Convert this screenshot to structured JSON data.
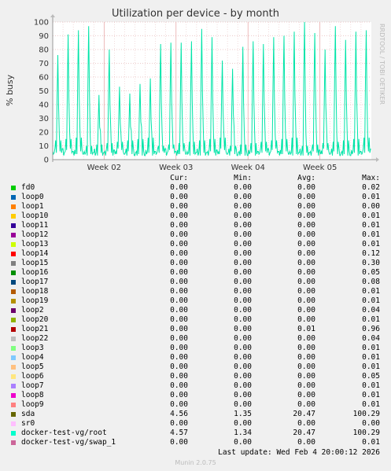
{
  "chart_data": {
    "type": "line",
    "title": "Utilization per device - by month",
    "ylabel": "% busy",
    "ylim": [
      0,
      100
    ],
    "yticks": [
      0,
      10,
      20,
      30,
      40,
      50,
      60,
      70,
      80,
      90,
      100
    ],
    "xtick_labels": [
      "Week 02",
      "Week 03",
      "Week 04",
      "Week 05"
    ],
    "grid": true,
    "series_color": "#00e4a8",
    "daily_peaks": [
      76,
      91,
      94,
      97,
      47,
      80,
      53,
      48,
      55,
      59,
      84,
      85,
      85,
      86,
      95,
      89,
      72,
      66,
      82,
      86,
      84,
      89,
      90,
      93,
      100,
      92,
      80,
      97,
      87,
      93,
      94
    ],
    "series": [
      {
        "name": "fd0",
        "color": "#00cc00",
        "cur": "0.00",
        "min": "0.00",
        "avg": "0.00",
        "max": "0.02"
      },
      {
        "name": "loop0",
        "color": "#0066b3",
        "cur": "0.00",
        "min": "0.00",
        "avg": "0.00",
        "max": "0.01"
      },
      {
        "name": "loop1",
        "color": "#ff8000",
        "cur": "0.00",
        "min": "0.00",
        "avg": "0.00",
        "max": "0.00"
      },
      {
        "name": "loop10",
        "color": "#ffcc00",
        "cur": "0.00",
        "min": "0.00",
        "avg": "0.00",
        "max": "0.01"
      },
      {
        "name": "loop11",
        "color": "#330099",
        "cur": "0.00",
        "min": "0.00",
        "avg": "0.00",
        "max": "0.01"
      },
      {
        "name": "loop12",
        "color": "#990099",
        "cur": "0.00",
        "min": "0.00",
        "avg": "0.00",
        "max": "0.01"
      },
      {
        "name": "loop13",
        "color": "#ccff00",
        "cur": "0.00",
        "min": "0.00",
        "avg": "0.00",
        "max": "0.01"
      },
      {
        "name": "loop14",
        "color": "#ff0000",
        "cur": "0.00",
        "min": "0.00",
        "avg": "0.00",
        "max": "0.12"
      },
      {
        "name": "loop15",
        "color": "#808080",
        "cur": "0.00",
        "min": "0.00",
        "avg": "0.00",
        "max": "0.30"
      },
      {
        "name": "loop16",
        "color": "#008f00",
        "cur": "0.00",
        "min": "0.00",
        "avg": "0.00",
        "max": "0.05"
      },
      {
        "name": "loop17",
        "color": "#00487d",
        "cur": "0.00",
        "min": "0.00",
        "avg": "0.00",
        "max": "0.08"
      },
      {
        "name": "loop18",
        "color": "#b35a00",
        "cur": "0.00",
        "min": "0.00",
        "avg": "0.00",
        "max": "0.01"
      },
      {
        "name": "loop19",
        "color": "#b38f00",
        "cur": "0.00",
        "min": "0.00",
        "avg": "0.00",
        "max": "0.01"
      },
      {
        "name": "loop2",
        "color": "#6b006b",
        "cur": "0.00",
        "min": "0.00",
        "avg": "0.00",
        "max": "0.04"
      },
      {
        "name": "loop20",
        "color": "#8fb300",
        "cur": "0.00",
        "min": "0.00",
        "avg": "0.00",
        "max": "0.01"
      },
      {
        "name": "loop21",
        "color": "#b30000",
        "cur": "0.00",
        "min": "0.00",
        "avg": "0.01",
        "max": "0.96"
      },
      {
        "name": "loop22",
        "color": "#bebebe",
        "cur": "0.00",
        "min": "0.00",
        "avg": "0.00",
        "max": "0.04"
      },
      {
        "name": "loop3",
        "color": "#80ff80",
        "cur": "0.00",
        "min": "0.00",
        "avg": "0.00",
        "max": "0.01"
      },
      {
        "name": "loop4",
        "color": "#80c9ff",
        "cur": "0.00",
        "min": "0.00",
        "avg": "0.00",
        "max": "0.01"
      },
      {
        "name": "loop5",
        "color": "#ffc080",
        "cur": "0.00",
        "min": "0.00",
        "avg": "0.00",
        "max": "0.01"
      },
      {
        "name": "loop6",
        "color": "#ffe680",
        "cur": "0.00",
        "min": "0.00",
        "avg": "0.00",
        "max": "0.05"
      },
      {
        "name": "loop7",
        "color": "#aa80ff",
        "cur": "0.00",
        "min": "0.00",
        "avg": "0.00",
        "max": "0.01"
      },
      {
        "name": "loop8",
        "color": "#ee00cc",
        "cur": "0.00",
        "min": "0.00",
        "avg": "0.00",
        "max": "0.01"
      },
      {
        "name": "loop9",
        "color": "#ff8080",
        "cur": "0.00",
        "min": "0.00",
        "avg": "0.00",
        "max": "0.01"
      },
      {
        "name": "sda",
        "color": "#666600",
        "cur": "4.56",
        "min": "1.35",
        "avg": "20.47",
        "max": "100.29"
      },
      {
        "name": "sr0",
        "color": "#ffbfff",
        "cur": "0.00",
        "min": "0.00",
        "avg": "0.00",
        "max": "0.00"
      },
      {
        "name": "docker-test-vg/root",
        "color": "#00ffcc",
        "cur": "4.57",
        "min": "1.34",
        "avg": "20.47",
        "max": "100.29"
      },
      {
        "name": "docker-test-vg/swap_1",
        "color": "#cc6699",
        "cur": "0.00",
        "min": "0.00",
        "avg": "0.00",
        "max": "0.01"
      }
    ]
  },
  "legend_headers": {
    "cur": "Cur:",
    "min": "Min:",
    "avg": "Avg:",
    "max": "Max:"
  },
  "last_update": "Last update: Wed Feb  4 20:00:12 2026",
  "watermark": "RRDTOOL / TOBI OETIKER",
  "footer": "Munin 2.0.75"
}
